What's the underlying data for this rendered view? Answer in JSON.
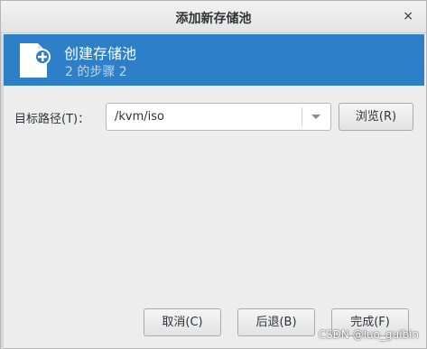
{
  "window": {
    "title": "添加新存储池",
    "close_glyph": "×"
  },
  "banner": {
    "heading": "创建存储池",
    "step": "2 的步骤 2",
    "icon": "new-document-icon"
  },
  "form": {
    "target_path_label": "目标路径(T)：",
    "target_path_value": "/kvm/iso",
    "browse_label": "浏览(R)"
  },
  "buttons": {
    "cancel_label": "取消(C)",
    "back_label": "后退(B)",
    "finish_label": "完成(F)"
  },
  "watermark": "CSDN @luo_guibin",
  "colors": {
    "banner": "#2d7fc7",
    "banner_step_text": "#bcd6ee",
    "dialog_bg": "#ededed"
  }
}
